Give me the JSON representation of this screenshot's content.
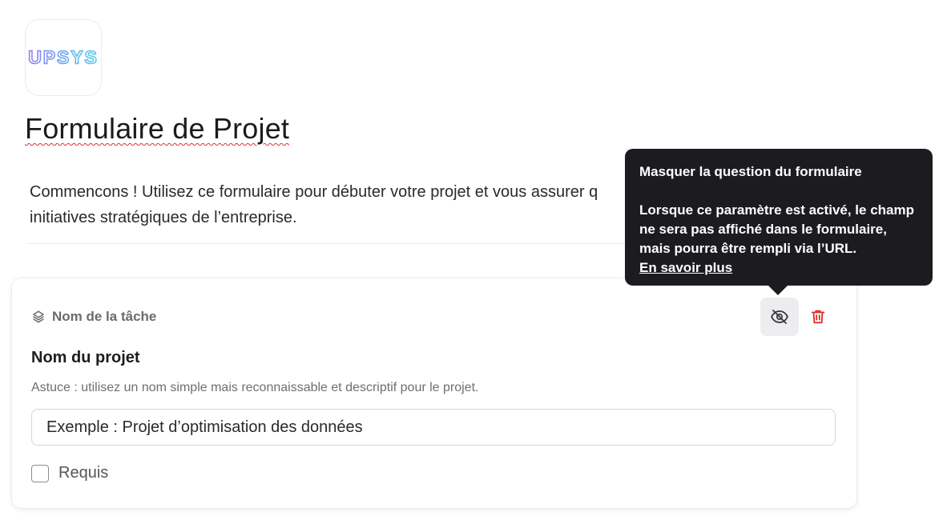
{
  "logo": {
    "text": "UPSYS"
  },
  "form": {
    "title": "Formulaire de Projet",
    "description": "Commencons ! Utilisez ce formulaire pour débuter votre projet et vous assurer q initiatives stratégiques de l’entreprise."
  },
  "field": {
    "type_label": "Nom de la tâche",
    "type_icon": "layers-icon",
    "question_label": "Nom du projet",
    "hint": "Astuce : utilisez un nom simple mais reconnaissable et descriptif pour le projet.",
    "input_placeholder": "Exemple : Projet d’optimisation des données",
    "required_label": "Requis",
    "required_checked": false,
    "hide_icon": "eye-off-icon",
    "delete_icon": "trash-icon"
  },
  "tooltip": {
    "title": "Masquer la question du formulaire",
    "body": "Lorsque ce paramètre est activé, le champ ne sera pas affiché dans le formulaire, mais pourra être rempli via l’URL.",
    "link": "En savoir plus"
  },
  "colors": {
    "tooltip_bg": "#1c1b1f",
    "delete_red": "#d8322c",
    "logo_gradient_start": "#8b7cf0",
    "logo_gradient_end": "#4fd0f0"
  }
}
